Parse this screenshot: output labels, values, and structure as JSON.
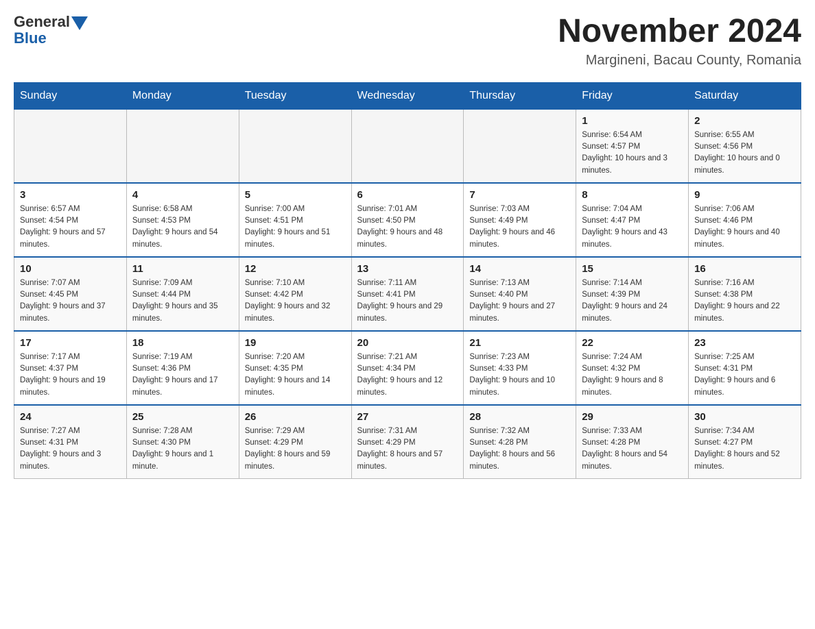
{
  "header": {
    "logo_general": "General",
    "logo_blue": "Blue",
    "month_title": "November 2024",
    "location": "Margineni, Bacau County, Romania"
  },
  "weekdays": [
    "Sunday",
    "Monday",
    "Tuesday",
    "Wednesday",
    "Thursday",
    "Friday",
    "Saturday"
  ],
  "weeks": [
    [
      {
        "day": "",
        "sunrise": "",
        "sunset": "",
        "daylight": ""
      },
      {
        "day": "",
        "sunrise": "",
        "sunset": "",
        "daylight": ""
      },
      {
        "day": "",
        "sunrise": "",
        "sunset": "",
        "daylight": ""
      },
      {
        "day": "",
        "sunrise": "",
        "sunset": "",
        "daylight": ""
      },
      {
        "day": "",
        "sunrise": "",
        "sunset": "",
        "daylight": ""
      },
      {
        "day": "1",
        "sunrise": "Sunrise: 6:54 AM",
        "sunset": "Sunset: 4:57 PM",
        "daylight": "Daylight: 10 hours and 3 minutes."
      },
      {
        "day": "2",
        "sunrise": "Sunrise: 6:55 AM",
        "sunset": "Sunset: 4:56 PM",
        "daylight": "Daylight: 10 hours and 0 minutes."
      }
    ],
    [
      {
        "day": "3",
        "sunrise": "Sunrise: 6:57 AM",
        "sunset": "Sunset: 4:54 PM",
        "daylight": "Daylight: 9 hours and 57 minutes."
      },
      {
        "day": "4",
        "sunrise": "Sunrise: 6:58 AM",
        "sunset": "Sunset: 4:53 PM",
        "daylight": "Daylight: 9 hours and 54 minutes."
      },
      {
        "day": "5",
        "sunrise": "Sunrise: 7:00 AM",
        "sunset": "Sunset: 4:51 PM",
        "daylight": "Daylight: 9 hours and 51 minutes."
      },
      {
        "day": "6",
        "sunrise": "Sunrise: 7:01 AM",
        "sunset": "Sunset: 4:50 PM",
        "daylight": "Daylight: 9 hours and 48 minutes."
      },
      {
        "day": "7",
        "sunrise": "Sunrise: 7:03 AM",
        "sunset": "Sunset: 4:49 PM",
        "daylight": "Daylight: 9 hours and 46 minutes."
      },
      {
        "day": "8",
        "sunrise": "Sunrise: 7:04 AM",
        "sunset": "Sunset: 4:47 PM",
        "daylight": "Daylight: 9 hours and 43 minutes."
      },
      {
        "day": "9",
        "sunrise": "Sunrise: 7:06 AM",
        "sunset": "Sunset: 4:46 PM",
        "daylight": "Daylight: 9 hours and 40 minutes."
      }
    ],
    [
      {
        "day": "10",
        "sunrise": "Sunrise: 7:07 AM",
        "sunset": "Sunset: 4:45 PM",
        "daylight": "Daylight: 9 hours and 37 minutes."
      },
      {
        "day": "11",
        "sunrise": "Sunrise: 7:09 AM",
        "sunset": "Sunset: 4:44 PM",
        "daylight": "Daylight: 9 hours and 35 minutes."
      },
      {
        "day": "12",
        "sunrise": "Sunrise: 7:10 AM",
        "sunset": "Sunset: 4:42 PM",
        "daylight": "Daylight: 9 hours and 32 minutes."
      },
      {
        "day": "13",
        "sunrise": "Sunrise: 7:11 AM",
        "sunset": "Sunset: 4:41 PM",
        "daylight": "Daylight: 9 hours and 29 minutes."
      },
      {
        "day": "14",
        "sunrise": "Sunrise: 7:13 AM",
        "sunset": "Sunset: 4:40 PM",
        "daylight": "Daylight: 9 hours and 27 minutes."
      },
      {
        "day": "15",
        "sunrise": "Sunrise: 7:14 AM",
        "sunset": "Sunset: 4:39 PM",
        "daylight": "Daylight: 9 hours and 24 minutes."
      },
      {
        "day": "16",
        "sunrise": "Sunrise: 7:16 AM",
        "sunset": "Sunset: 4:38 PM",
        "daylight": "Daylight: 9 hours and 22 minutes."
      }
    ],
    [
      {
        "day": "17",
        "sunrise": "Sunrise: 7:17 AM",
        "sunset": "Sunset: 4:37 PM",
        "daylight": "Daylight: 9 hours and 19 minutes."
      },
      {
        "day": "18",
        "sunrise": "Sunrise: 7:19 AM",
        "sunset": "Sunset: 4:36 PM",
        "daylight": "Daylight: 9 hours and 17 minutes."
      },
      {
        "day": "19",
        "sunrise": "Sunrise: 7:20 AM",
        "sunset": "Sunset: 4:35 PM",
        "daylight": "Daylight: 9 hours and 14 minutes."
      },
      {
        "day": "20",
        "sunrise": "Sunrise: 7:21 AM",
        "sunset": "Sunset: 4:34 PM",
        "daylight": "Daylight: 9 hours and 12 minutes."
      },
      {
        "day": "21",
        "sunrise": "Sunrise: 7:23 AM",
        "sunset": "Sunset: 4:33 PM",
        "daylight": "Daylight: 9 hours and 10 minutes."
      },
      {
        "day": "22",
        "sunrise": "Sunrise: 7:24 AM",
        "sunset": "Sunset: 4:32 PM",
        "daylight": "Daylight: 9 hours and 8 minutes."
      },
      {
        "day": "23",
        "sunrise": "Sunrise: 7:25 AM",
        "sunset": "Sunset: 4:31 PM",
        "daylight": "Daylight: 9 hours and 6 minutes."
      }
    ],
    [
      {
        "day": "24",
        "sunrise": "Sunrise: 7:27 AM",
        "sunset": "Sunset: 4:31 PM",
        "daylight": "Daylight: 9 hours and 3 minutes."
      },
      {
        "day": "25",
        "sunrise": "Sunrise: 7:28 AM",
        "sunset": "Sunset: 4:30 PM",
        "daylight": "Daylight: 9 hours and 1 minute."
      },
      {
        "day": "26",
        "sunrise": "Sunrise: 7:29 AM",
        "sunset": "Sunset: 4:29 PM",
        "daylight": "Daylight: 8 hours and 59 minutes."
      },
      {
        "day": "27",
        "sunrise": "Sunrise: 7:31 AM",
        "sunset": "Sunset: 4:29 PM",
        "daylight": "Daylight: 8 hours and 57 minutes."
      },
      {
        "day": "28",
        "sunrise": "Sunrise: 7:32 AM",
        "sunset": "Sunset: 4:28 PM",
        "daylight": "Daylight: 8 hours and 56 minutes."
      },
      {
        "day": "29",
        "sunrise": "Sunrise: 7:33 AM",
        "sunset": "Sunset: 4:28 PM",
        "daylight": "Daylight: 8 hours and 54 minutes."
      },
      {
        "day": "30",
        "sunrise": "Sunrise: 7:34 AM",
        "sunset": "Sunset: 4:27 PM",
        "daylight": "Daylight: 8 hours and 52 minutes."
      }
    ]
  ]
}
